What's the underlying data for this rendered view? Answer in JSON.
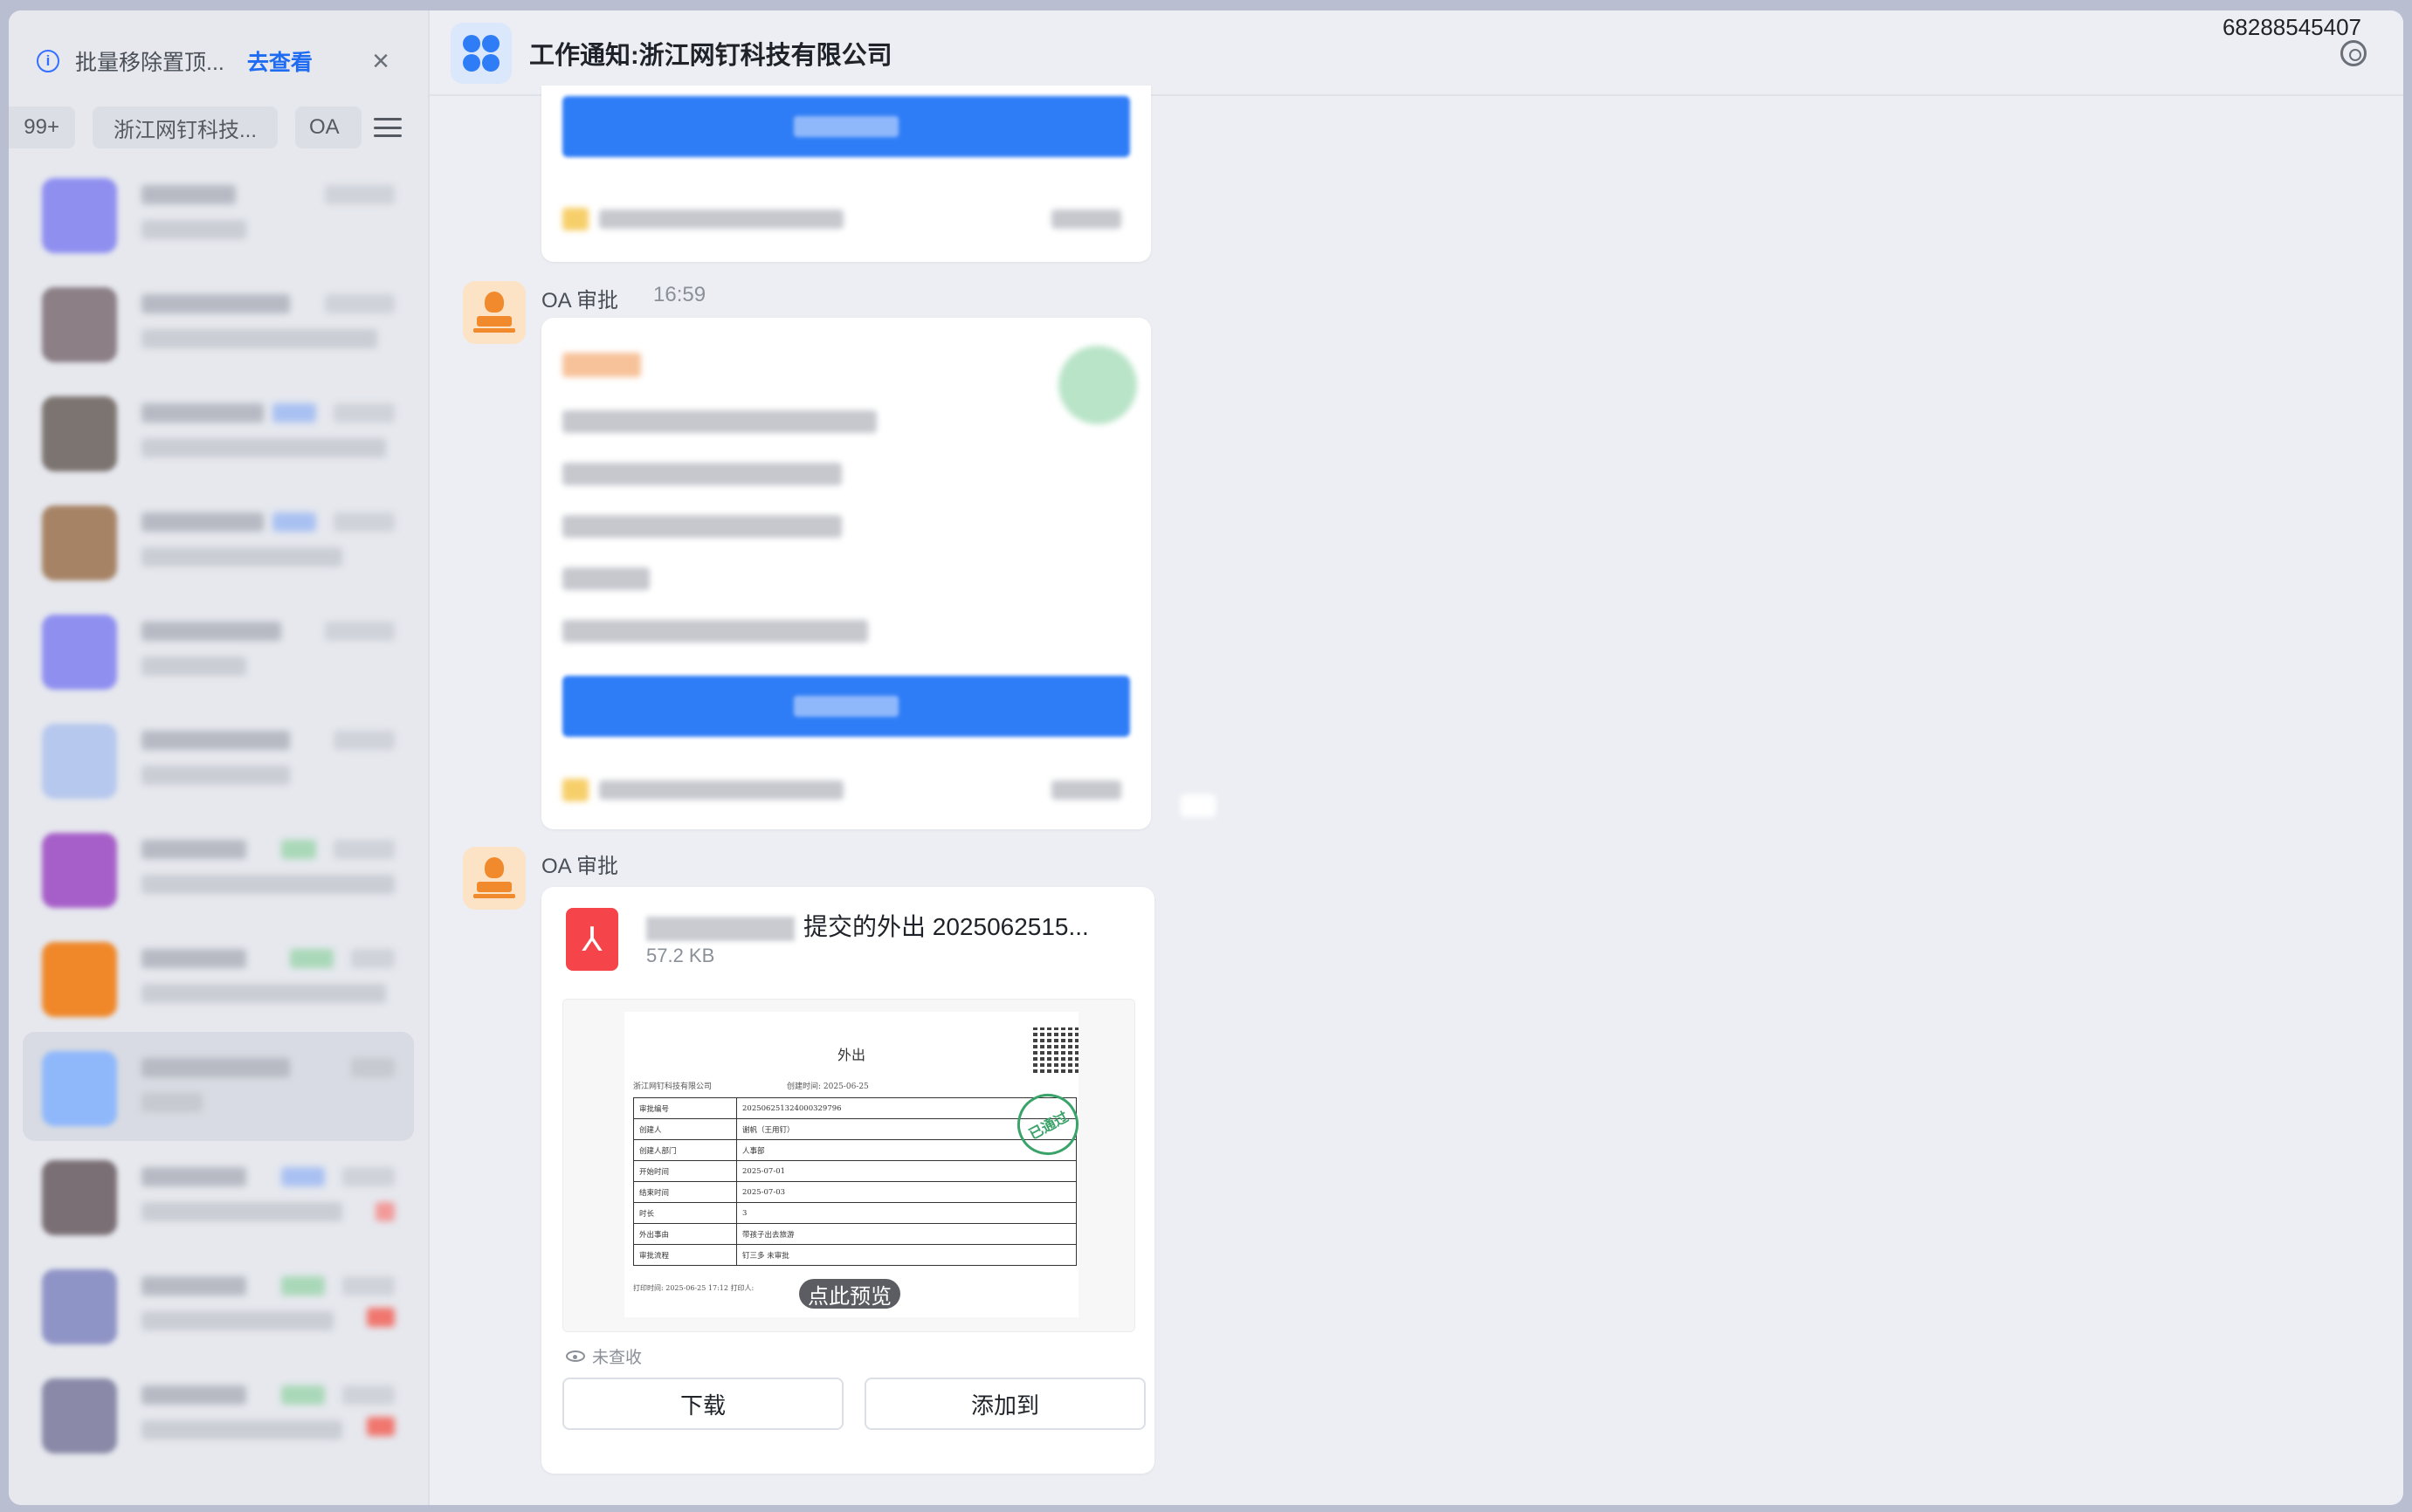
{
  "sidebar": {
    "notice": {
      "text": "批量移除置顶...",
      "link": "去查看"
    },
    "chips": [
      {
        "label": "99+"
      },
      {
        "label": "浙江网钉科技..."
      },
      {
        "label": "OA"
      }
    ]
  },
  "header": {
    "title": "工作通知:浙江网钉科技有限公司",
    "account_id": "68288545407"
  },
  "messages": [
    {
      "sender": "OA 审批",
      "time": "16:59"
    },
    {
      "sender": "OA 审批",
      "file": {
        "name_visible": "提交的外出 2025062515...",
        "size": "57.2 KB",
        "preview_button": "点此预览",
        "read_status": "未查收",
        "download_label": "下载",
        "add_to_label": "添加到"
      },
      "document": {
        "title": "外出",
        "company": "浙江网钉科技有限公司",
        "created_at": "创建时间: 2025-06-25",
        "stamp": "已通过",
        "rows": [
          {
            "key": "审批编号",
            "value": "202506251324000329796"
          },
          {
            "key": "创建人",
            "value": "谢帆（王用钉）"
          },
          {
            "key": "创建人部门",
            "value": "人事部"
          },
          {
            "key": "开始时间",
            "value": "2025-07-01"
          },
          {
            "key": "结束时间",
            "value": "2025-07-03"
          },
          {
            "key": "时长",
            "value": "3"
          },
          {
            "key": "外出事由",
            "value": "带孩子出去旅游"
          },
          {
            "key": "审批流程",
            "value": "钉三多 未审批"
          }
        ],
        "footer": "打印时间: 2025-06-25 17:12    打印人:"
      }
    }
  ],
  "colors": {
    "accent": "#2f7df6",
    "pdf_red": "#f5454b",
    "stamp_green": "#3aa36a",
    "sender_orange": "#f08a2c"
  }
}
